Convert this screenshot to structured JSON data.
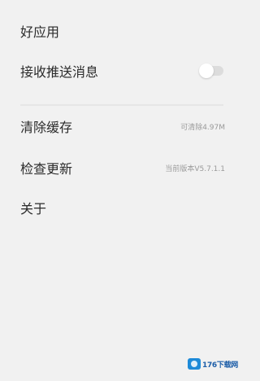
{
  "settings": {
    "items": [
      {
        "label": "好应用"
      },
      {
        "label": "接收推送消息",
        "toggle_on": false
      },
      {
        "label": "清除缓存",
        "value": "可清除4.97M"
      },
      {
        "label": "检查更新",
        "value": "当前版本V5.7.1.1"
      },
      {
        "label": "关于"
      }
    ]
  },
  "watermark": {
    "text": "176下载网",
    "logo_color": "#1d8ad8",
    "text_color": "#1d5ea8"
  },
  "colors": {
    "background": "#f1f1f1",
    "label": "#2b2b2b",
    "secondary": "#9a9a9a",
    "divider": "#e6e6e6"
  }
}
